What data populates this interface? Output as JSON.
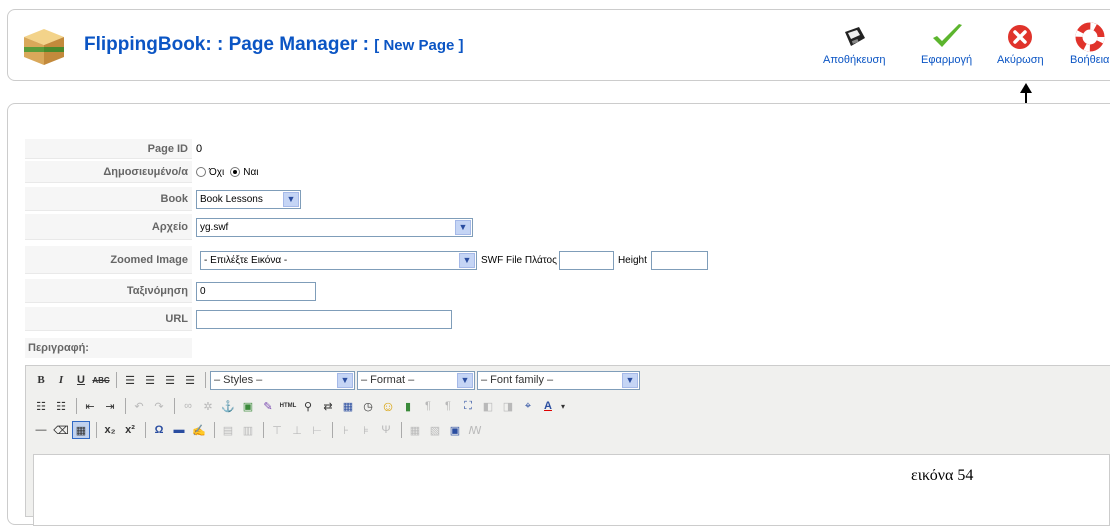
{
  "header": {
    "title_main": "FlippingBook: : Page Manager :",
    "title_sub": "[ New Page ]"
  },
  "toolbar": [
    {
      "label": "Αποθήκευση",
      "icon": "save-icon"
    },
    {
      "label": "Εφαρμογή",
      "icon": "apply-checkmark-icon"
    },
    {
      "label": "Ακύρωση",
      "icon": "cancel-icon"
    },
    {
      "label": "Βοήθεια",
      "icon": "help-lifebuoy-icon"
    }
  ],
  "form": {
    "page_id": {
      "label": "Page ID",
      "value": "0"
    },
    "published": {
      "label": "Δημοσιευμένο/α",
      "no": "Όχι",
      "yes": "Ναι",
      "selected": "Ναι"
    },
    "book": {
      "label": "Book",
      "value": "Book Lessons"
    },
    "file": {
      "label": "Αρχείο",
      "value": "yg.swf"
    },
    "zoomed": {
      "label": "Zoomed Image",
      "value": "- Επιλέξτε Εικόνα -",
      "swf_width_label": "SWF File Πλάτος",
      "height_label": "Height",
      "swf_width": "",
      "height": ""
    },
    "ordering": {
      "label": "Ταξινόμηση",
      "value": "0"
    },
    "url": {
      "label": "URL",
      "value": ""
    },
    "description": {
      "label": "Περιγραφή:"
    }
  },
  "editor": {
    "styles": "– Styles –",
    "format": "– Format –",
    "font_family": "– Font family –",
    "caption": "εικόνα 54"
  },
  "colors": {
    "accent": "#0b55c4",
    "label_bg": "#f6f6f6",
    "editor_bg": "#f0f0ee"
  }
}
